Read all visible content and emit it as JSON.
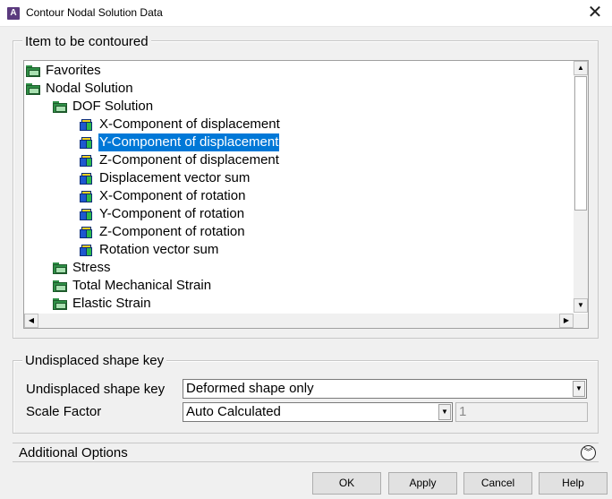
{
  "window": {
    "title": "Contour Nodal Solution Data",
    "app_icon_letter": "A",
    "close_glyph": "✕"
  },
  "item_group": {
    "legend": "Item to be contoured",
    "tree": [
      {
        "label": "Favorites",
        "icon": "folder-closed-icon",
        "depth": 0,
        "selected": false
      },
      {
        "label": "Nodal Solution",
        "icon": "folder-open-icon",
        "depth": 0,
        "selected": false
      },
      {
        "label": "DOF Solution",
        "icon": "folder-open-icon",
        "depth": 1,
        "selected": false
      },
      {
        "label": "X-Component of displacement",
        "icon": "cube-icon",
        "depth": 2,
        "selected": false
      },
      {
        "label": "Y-Component of displacement",
        "icon": "cube-icon",
        "depth": 2,
        "selected": true
      },
      {
        "label": "Z-Component of displacement",
        "icon": "cube-icon",
        "depth": 2,
        "selected": false
      },
      {
        "label": "Displacement vector sum",
        "icon": "cube-icon",
        "depth": 2,
        "selected": false
      },
      {
        "label": "X-Component of rotation",
        "icon": "cube-icon",
        "depth": 2,
        "selected": false
      },
      {
        "label": "Y-Component of rotation",
        "icon": "cube-icon",
        "depth": 2,
        "selected": false
      },
      {
        "label": "Z-Component of rotation",
        "icon": "cube-icon",
        "depth": 2,
        "selected": false
      },
      {
        "label": "Rotation vector sum",
        "icon": "cube-icon",
        "depth": 2,
        "selected": false
      },
      {
        "label": "Stress",
        "icon": "folder-closed-icon",
        "depth": 1,
        "selected": false
      },
      {
        "label": "Total Mechanical Strain",
        "icon": "folder-closed-icon",
        "depth": 1,
        "selected": false
      },
      {
        "label": "Elastic Strain",
        "icon": "folder-closed-icon",
        "depth": 1,
        "selected": false
      }
    ]
  },
  "shape_group": {
    "legend": "Undisplaced shape key",
    "undisplaced_label": "Undisplaced shape key",
    "undisplaced_value": "Deformed shape only",
    "scale_label": "Scale Factor",
    "scale_value": "Auto Calculated",
    "scale_number": "1"
  },
  "additional": {
    "label": "Additional Options"
  },
  "buttons": {
    "ok": "OK",
    "apply": "Apply",
    "cancel": "Cancel",
    "help": "Help"
  },
  "colors": {
    "selection": "#0078d7",
    "background": "#f0f0f0"
  }
}
